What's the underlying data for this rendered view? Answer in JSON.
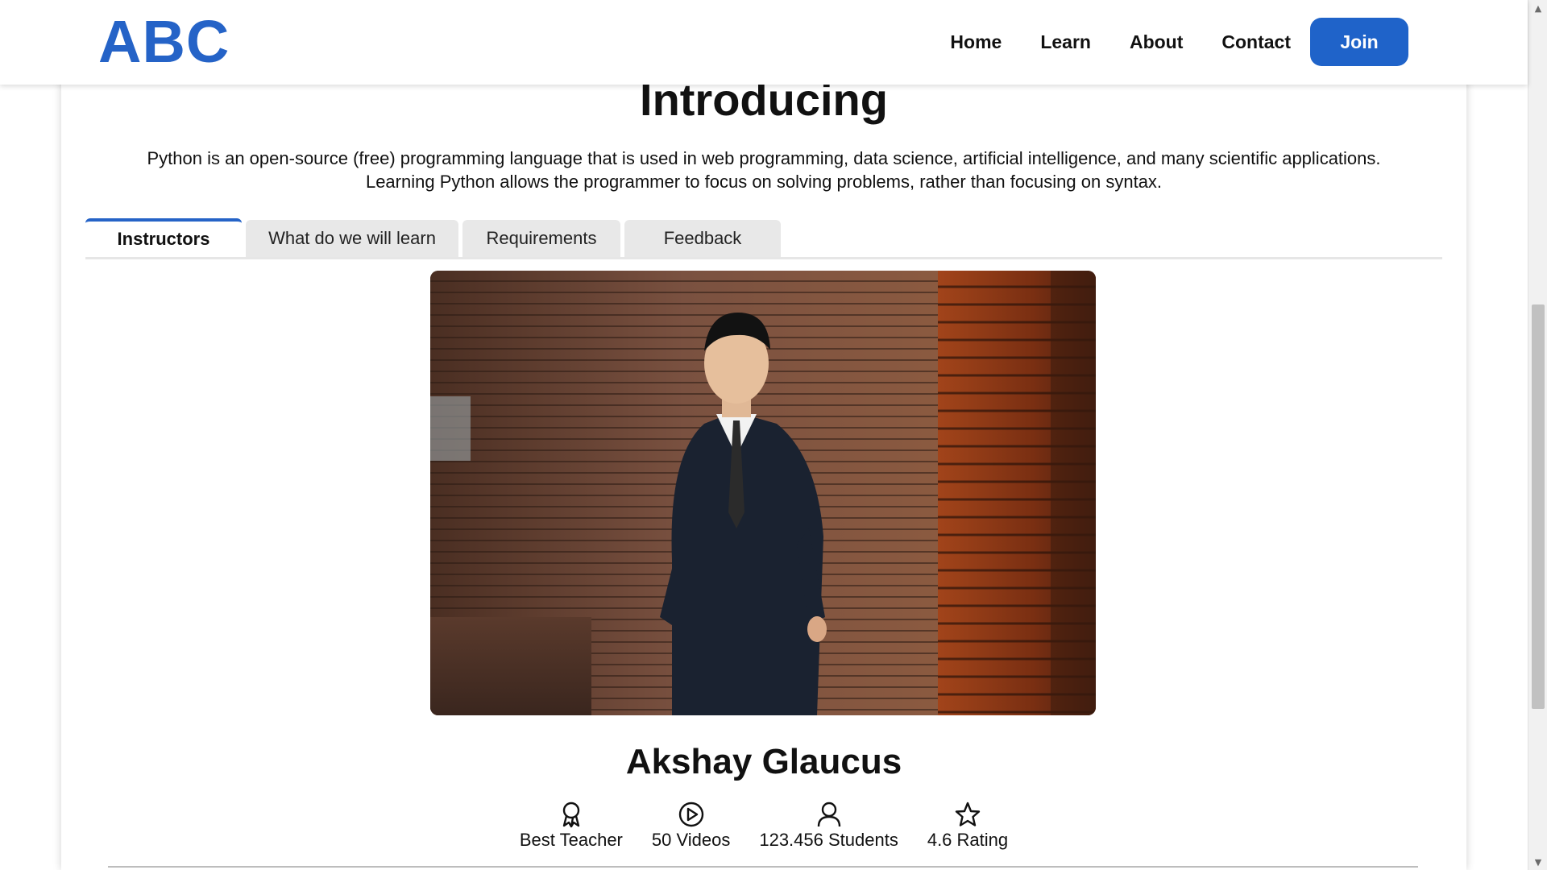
{
  "header": {
    "logo": "ABC",
    "nav": {
      "home": "Home",
      "learn": "Learn",
      "about": "About",
      "contact": "Contact"
    },
    "join_label": "Join"
  },
  "intro": {
    "title": "Introducing",
    "description_line1": "Python is an open-source (free) programming language that is used in web programming, data science, artificial intelligence, and many scientific applications.",
    "description_line2": "Learning Python allows the programmer to focus on solving problems, rather than focusing on syntax."
  },
  "tabs": [
    {
      "label": "Instructors",
      "active": true
    },
    {
      "label": "What do we will learn",
      "active": false
    },
    {
      "label": "Requirements",
      "active": false
    },
    {
      "label": "Feedback",
      "active": false
    }
  ],
  "instructor": {
    "name": "Akshay Glaucus",
    "stats": [
      {
        "icon": "award-icon",
        "label": "Best Teacher"
      },
      {
        "icon": "play-circle-icon",
        "label": "50 Videos"
      },
      {
        "icon": "user-icon",
        "label": "123.456 Students"
      },
      {
        "icon": "star-icon",
        "label": "4.6 Rating"
      }
    ]
  },
  "colors": {
    "brand": "#2563c7",
    "join_button": "#1f63c9",
    "tab_inactive": "#e8e8e8"
  }
}
